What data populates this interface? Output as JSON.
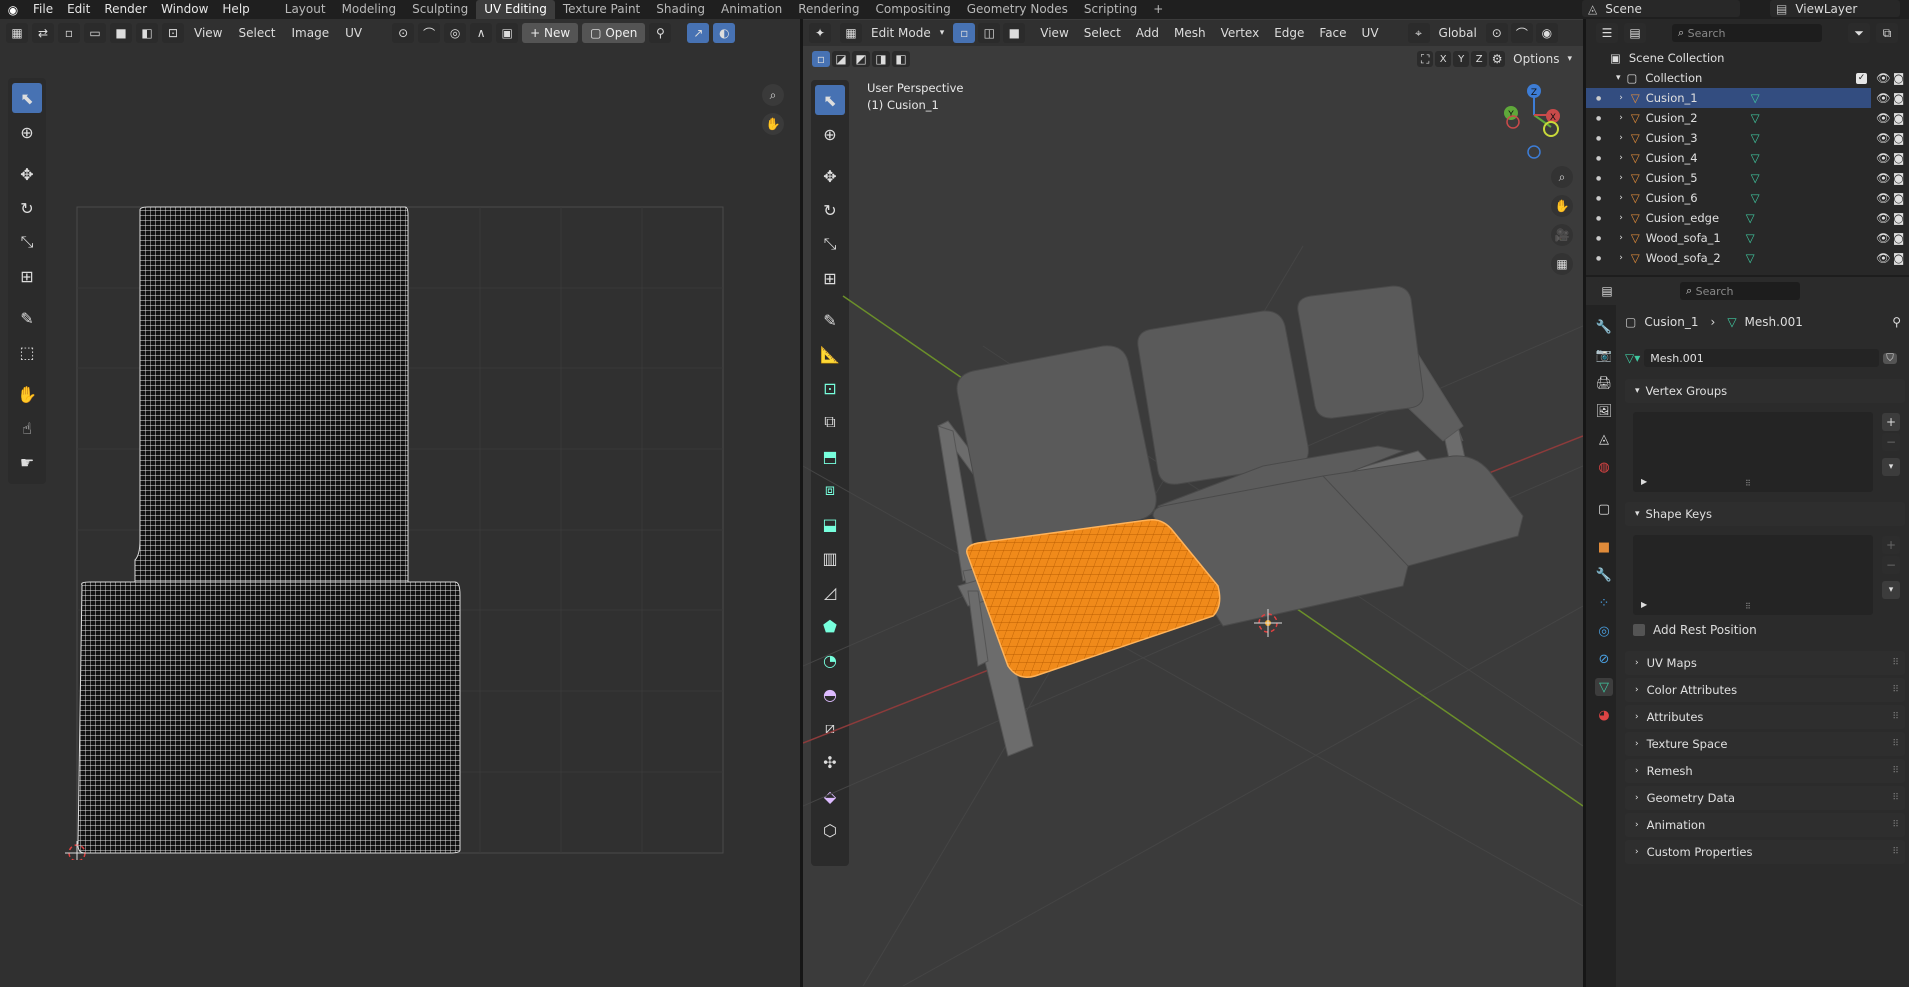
{
  "topbar": {
    "menus": [
      "File",
      "Edit",
      "Render",
      "Window",
      "Help"
    ],
    "workspaces": [
      "Layout",
      "Modeling",
      "Sculpting",
      "UV Editing",
      "Texture Paint",
      "Shading",
      "Animation",
      "Rendering",
      "Compositing",
      "Geometry Nodes",
      "Scripting"
    ],
    "active_workspace": "UV Editing",
    "scene": "Scene",
    "view_layer": "ViewLayer"
  },
  "uv_editor": {
    "menus": [
      "View",
      "Select",
      "Image",
      "UV"
    ],
    "new_label": "New",
    "open_label": "Open"
  },
  "viewport": {
    "mode": "Edit Mode",
    "menus": [
      "View",
      "Select",
      "Add",
      "Mesh",
      "Vertex",
      "Edge",
      "Face",
      "UV"
    ],
    "orientation": "Global",
    "axes": [
      "X",
      "Y",
      "Z"
    ],
    "options_label": "Options",
    "overlay_title": "User Perspective",
    "overlay_object": "(1) Cusion_1",
    "gizmo": {
      "x": "X",
      "y": "Y",
      "z": "Z"
    }
  },
  "outliner": {
    "search_placeholder": "Search",
    "scene_collection": "Scene Collection",
    "collection": "Collection",
    "objects": [
      "Cusion_1",
      "Cusion_2",
      "Cusion_3",
      "Cusion_4",
      "Cusion_5",
      "Cusion_6",
      "Cusion_edge",
      "Wood_sofa_1",
      "Wood_sofa_2"
    ]
  },
  "properties": {
    "search_placeholder": "Search",
    "breadcrumb_object": "Cusion_1",
    "breadcrumb_mesh": "Mesh.001",
    "mesh_name": "Mesh.001",
    "vertex_groups": "Vertex Groups",
    "shape_keys": "Shape Keys",
    "add_rest_position": "Add Rest Position",
    "sections": [
      "UV Maps",
      "Color Attributes",
      "Attributes",
      "Texture Space",
      "Remesh",
      "Geometry Data",
      "Animation",
      "Custom Properties"
    ]
  },
  "colors": {
    "accent": "#4772b3",
    "selected_mesh": "#ff8a1a",
    "mesh_icon": "#40c8a0",
    "object_icon": "#e08b3a"
  }
}
